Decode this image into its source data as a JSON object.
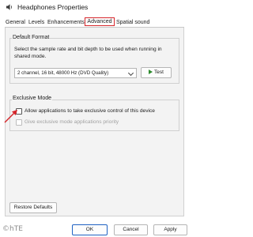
{
  "window": {
    "title": "Headphones Properties",
    "icon": "speaker-icon"
  },
  "tabs": [
    {
      "label": "General",
      "active": false
    },
    {
      "label": "Levels",
      "active": false
    },
    {
      "label": "Enhancements",
      "active": false
    },
    {
      "label": "Advanced",
      "active": true
    },
    {
      "label": "Spatial sound",
      "active": false
    }
  ],
  "default_format": {
    "group_label": "Default Format",
    "description": "Select the sample rate and bit depth to be used when running in shared mode.",
    "selected_value": "2 channel, 16 bit, 48000 Hz (DVD Quality)",
    "test_button": "Test"
  },
  "exclusive_mode": {
    "group_label": "Exclusive Mode",
    "allow_label": "Allow applications to take exclusive control of this device",
    "allow_checked": false,
    "priority_label": "Give exclusive mode applications priority",
    "priority_checked": false,
    "priority_enabled": false
  },
  "restore_button": "Restore Defaults",
  "footer": {
    "ok": "OK",
    "cancel": "Cancel",
    "apply": "Apply"
  },
  "watermark": "©hTE",
  "colors": {
    "highlight_red": "#d6262b",
    "ok_border": "#1f62c3",
    "play_green": "#2e8b2e"
  }
}
